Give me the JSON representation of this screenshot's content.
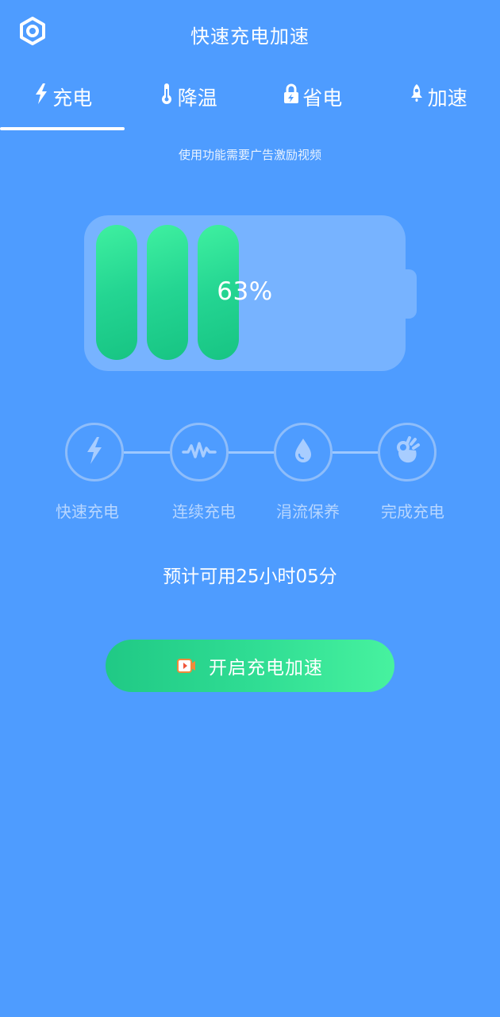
{
  "header": {
    "title": "快速充电加速",
    "settings_icon": "gear-hexagon-icon"
  },
  "tabs": [
    {
      "label": "充电",
      "icon": "lightning-icon",
      "active": true
    },
    {
      "label": "降温",
      "icon": "thermometer-icon",
      "active": false
    },
    {
      "label": "省电",
      "icon": "lock-bolt-icon",
      "active": false
    },
    {
      "label": "加速",
      "icon": "rocket-icon",
      "active": false
    }
  ],
  "ad_notice": "使用功能需要广告激励视频",
  "battery": {
    "percent_label": "63%",
    "level": 0.63,
    "filled_cells": 3
  },
  "steps": [
    {
      "label": "快速充电",
      "icon": "lightning-icon"
    },
    {
      "label": "连续充电",
      "icon": "pulse-icon"
    },
    {
      "label": "涓流保养",
      "icon": "drop-icon"
    },
    {
      "label": "完成充电",
      "icon": "ok-hand-icon"
    }
  ],
  "estimate": "预计可用25小时05分",
  "boost_button": {
    "label": "开启充电加速",
    "icon": "video-play-icon"
  },
  "colors": {
    "background": "#4e9cff",
    "battery_body": "#77b3ff",
    "cell_green": "#24d592",
    "step_border": "#8ebdfa",
    "step_label": "#b7d6ff"
  }
}
